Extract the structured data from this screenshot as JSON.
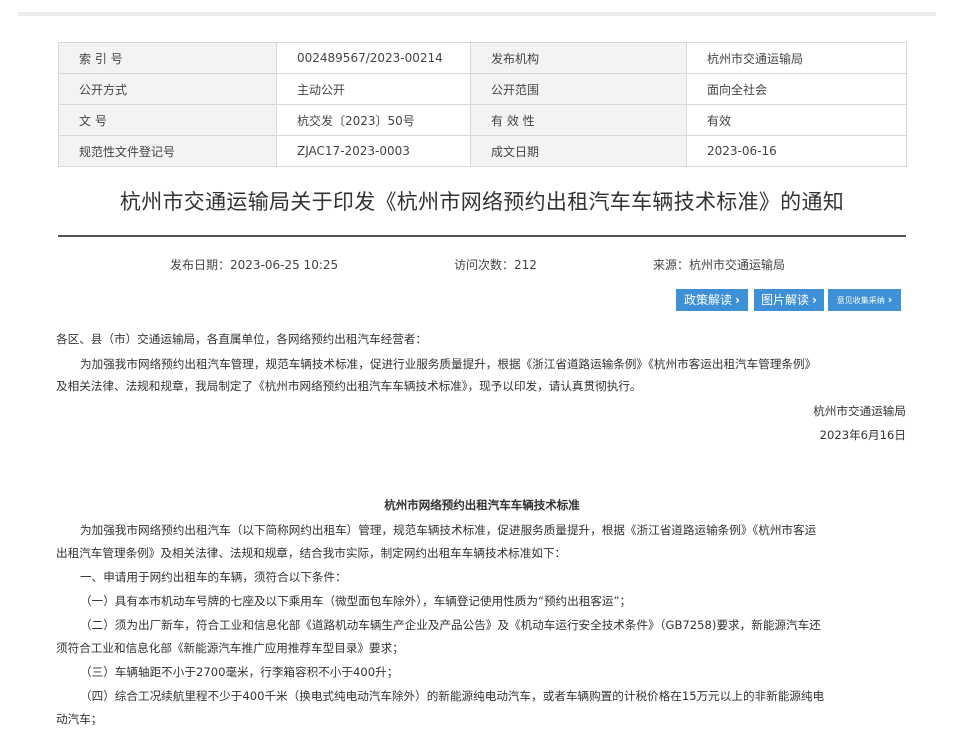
{
  "meta": {
    "rows": [
      [
        "索 引 号",
        "002489567/2023-00214",
        "发布机构",
        "杭州市交通运输局"
      ],
      [
        "公开方式",
        "主动公开",
        "公开范围",
        "面向全社会"
      ],
      [
        "文 号",
        "杭交发〔2023〕50号",
        "有 效 性",
        "有效"
      ],
      [
        "规范性文件登记号",
        "ZJAC17-2023-0003",
        "成文日期",
        "2023-06-16"
      ]
    ]
  },
  "title": "杭州市交通运输局关于印发《杭州市网络预约出租汽车车辆技术标准》的通知",
  "info": {
    "publish_date": "发布日期：2023-06-25 10:25",
    "visits": "访问次数：212",
    "source": "来源：杭州市交通运输局"
  },
  "buttons": {
    "policy": "政策解读",
    "picture": "图片解读",
    "feedback": "意见收集采纳",
    "arrow": "›"
  },
  "notice": {
    "salutation": "各区、县（市）交通运输局，各直属单位，各网络预约出租汽车经营者：",
    "body_line1": "为加强我市网络预约出租汽车管理，规范车辆技术标准，促进行业服务质量提升，根据《浙江省道路运输条例》《杭州市客运出租汽车管理条例》",
    "body_line2": "及相关法律、法规和规章，我局制定了《杭州市网络预约出租汽车车辆技术标准》，现予以印发，请认真贯彻执行。",
    "signature": "杭州市交通运输局",
    "date": "2023年6月16日"
  },
  "standard": {
    "heading": "杭州市网络预约出租汽车车辆技术标准",
    "intro_line1": "为加强我市网络预约出租汽车（以下简称网约出租车）管理，规范车辆技术标准，促进服务质量提升，根据《浙江省道路运输条例》《杭州市客运",
    "intro_line2": "出租汽车管理条例》及相关法律、法规和规章，结合我市实际，制定网约出租车车辆技术标准如下：",
    "section1": "一、申请用于网约出租车的车辆，须符合以下条件：",
    "item1": "（一）具有本市机动车号牌的七座及以下乘用车（微型面包车除外），车辆登记使用性质为“预约出租客运”；",
    "item2_line1": "（二）须为出厂新车，符合工业和信息化部《道路机动车辆生产企业及产品公告》及《机动车运行安全技术条件》（GB7258)要求，新能源汽车还",
    "item2_line2": "须符合工业和信息化部《新能源汽车推广应用推荐车型目录》要求；",
    "item3": "（三）车辆轴距不小于2700毫米，行李箱容积不小于400升；",
    "item4_line1": "（四）综合工况续航里程不少于400千米（换电式纯电动汽车除外）的新能源纯电动汽车，或者车辆购置的计税价格在15万元以上的非新能源纯电",
    "item4_line2": "动汽车；"
  }
}
